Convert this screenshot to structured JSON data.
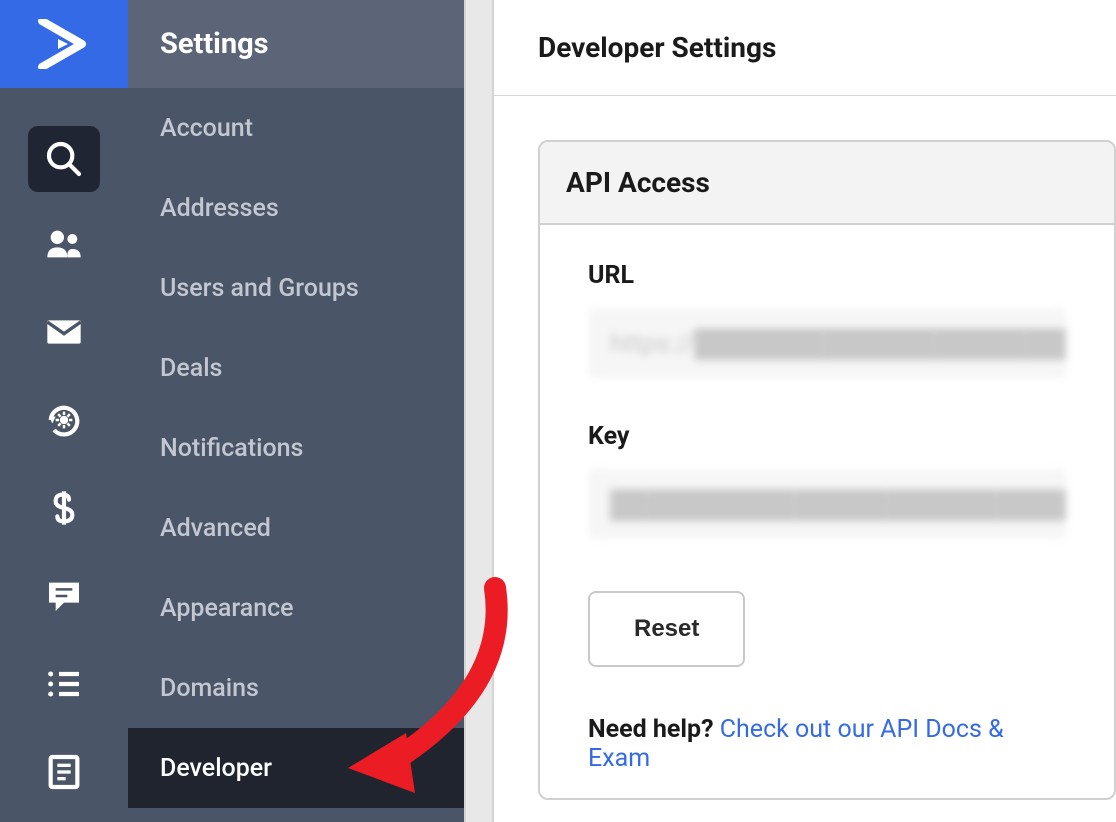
{
  "sidebar": {
    "header": "Settings",
    "items": [
      {
        "label": "Account",
        "active": false
      },
      {
        "label": "Addresses",
        "active": false
      },
      {
        "label": "Users and Groups",
        "active": false
      },
      {
        "label": "Deals",
        "active": false
      },
      {
        "label": "Notifications",
        "active": false
      },
      {
        "label": "Advanced",
        "active": false
      },
      {
        "label": "Appearance",
        "active": false
      },
      {
        "label": "Domains",
        "active": false
      },
      {
        "label": "Developer",
        "active": true
      }
    ]
  },
  "main": {
    "title": "Developer Settings",
    "card": {
      "title": "API Access",
      "url_label": "URL",
      "url_value": "https://████████████████████████",
      "key_label": "Key",
      "key_value": "████████████████████████████████",
      "reset_label": "Reset",
      "help_prefix": "Need help? ",
      "help_link": "Check out our API Docs & Exam"
    }
  }
}
